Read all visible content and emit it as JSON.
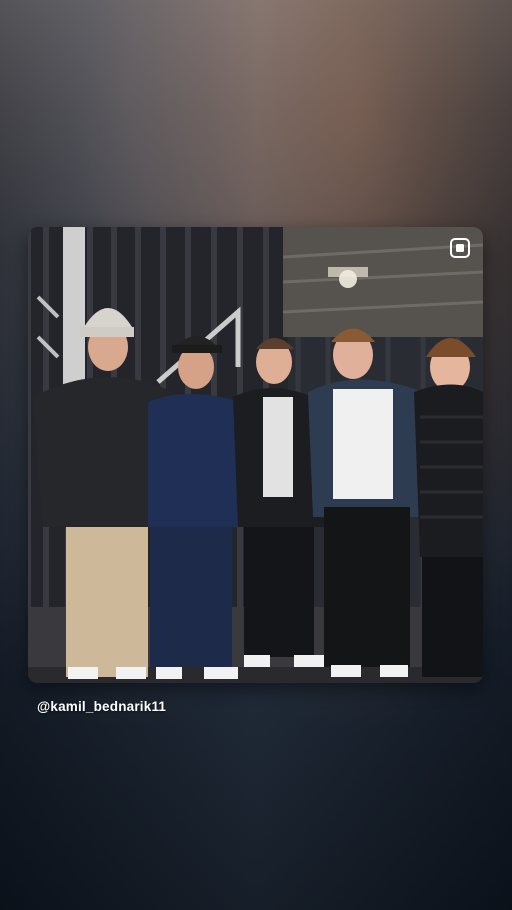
{
  "story": {
    "caption": "@kamil_bednarik11",
    "photo_alt": "Five young men posing together in front of a dark curtain",
    "share_icon": "square-share-icon"
  },
  "colors": {
    "background_top": "#6e6c6f",
    "background_bottom": "#0f1722",
    "caption_text": "#ffffff"
  }
}
